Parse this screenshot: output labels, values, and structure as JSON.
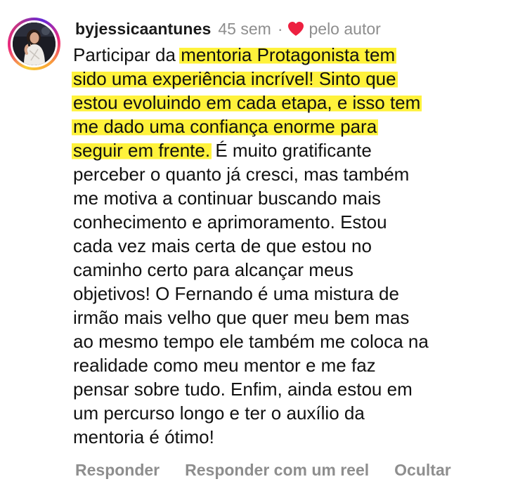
{
  "comment": {
    "username": "byjessicaantunes",
    "time": "45 sem",
    "separator": "·",
    "liked_by_author_label": "pelo autor",
    "colors": {
      "highlight": "#fff23b",
      "heart": "#ed2040",
      "muted_text": "#8e8e8e"
    },
    "lines": [
      [
        {
          "t": "Participar da ",
          "h": false
        },
        {
          "t": "mentoria Protagonista tem",
          "h": true
        }
      ],
      [
        {
          "t": "sido uma experiência incrível! Sinto que",
          "h": true
        }
      ],
      [
        {
          "t": "estou evoluindo em cada etapa, e isso tem",
          "h": true
        }
      ],
      [
        {
          "t": "me dado uma confiança enorme para",
          "h": true
        }
      ],
      [
        {
          "t": "seguir em frente.",
          "h": true
        },
        {
          "t": " É muito gratificante",
          "h": false
        }
      ],
      [
        {
          "t": "perceber o quanto já cresci, mas também",
          "h": false
        }
      ],
      [
        {
          "t": "me motiva a continuar buscando mais",
          "h": false
        }
      ],
      [
        {
          "t": "conhecimento e aprimoramento. Estou",
          "h": false
        }
      ],
      [
        {
          "t": "cada vez mais certa de que estou no",
          "h": false
        }
      ],
      [
        {
          "t": "caminho certo para alcançar meus",
          "h": false
        }
      ],
      [
        {
          "t": "objetivos! O Fernando é uma mistura de",
          "h": false
        }
      ],
      [
        {
          "t": "irmão mais velho que quer meu bem mas",
          "h": false
        }
      ],
      [
        {
          "t": "ao mesmo tempo ele também me coloca na",
          "h": false
        }
      ],
      [
        {
          "t": "realidade como meu mentor e me faz",
          "h": false
        }
      ],
      [
        {
          "t": "pensar sobre tudo. Enfim, ainda estou em",
          "h": false
        }
      ],
      [
        {
          "t": "um percurso longo e ter o auxílio da",
          "h": false
        }
      ],
      [
        {
          "t": "mentoria é ótimo!",
          "h": false
        }
      ]
    ]
  },
  "actions": {
    "reply_label": "Responder",
    "reply_reel_label": "Responder com um reel",
    "hide_label": "Ocultar"
  }
}
